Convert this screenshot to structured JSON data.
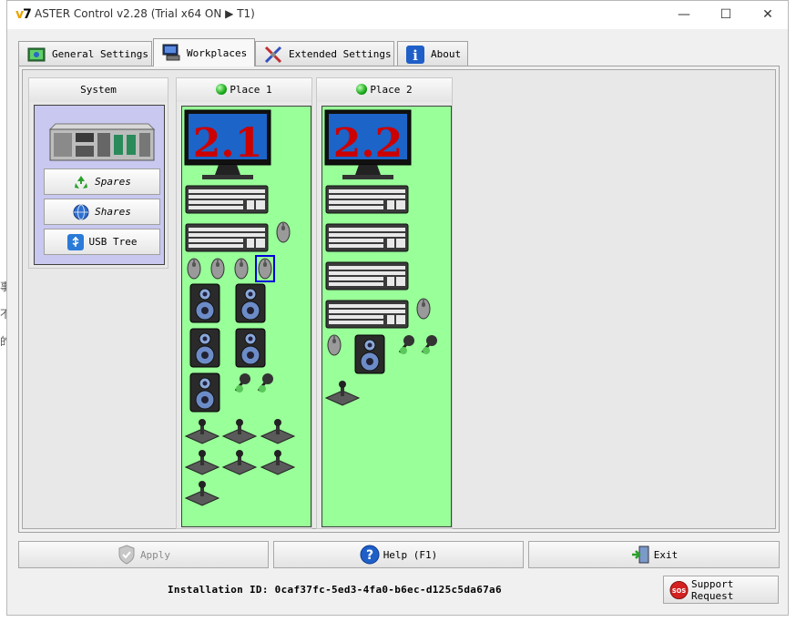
{
  "background_fragments": [
    "事",
    "不",
    "的"
  ],
  "window": {
    "title": "ASTER Control v2.28 (Trial x64 ON ▶ T1)",
    "app_icon_text": "v7",
    "minimize": "—",
    "maximize": "☐",
    "close": "✕"
  },
  "tabs": [
    {
      "label": "General Settings",
      "icon": "general-settings-icon",
      "active": false
    },
    {
      "label": "Workplaces",
      "icon": "workplaces-icon",
      "active": true
    },
    {
      "label": "Extended Settings",
      "icon": "extended-settings-icon",
      "active": false
    },
    {
      "label": "About",
      "icon": "info-icon",
      "active": false
    }
  ],
  "system": {
    "header": "System",
    "buttons": [
      {
        "label": "Spares",
        "icon": "recycle-icon"
      },
      {
        "label": "Shares",
        "icon": "globe-icon"
      },
      {
        "label": "USB Tree",
        "icon": "usb-icon"
      }
    ]
  },
  "places": [
    {
      "header": "Place 1",
      "monitor_label": "2.1",
      "status_color": "#18a818"
    },
    {
      "header": "Place 2",
      "monitor_label": "2.2",
      "status_color": "#18a818"
    }
  ],
  "buttons": {
    "apply": "Apply",
    "help": "Help (F1)",
    "exit": "Exit",
    "support": "Support Request",
    "sos": "SOS"
  },
  "installation_id": "Installation ID: 0caf37fc-5ed3-4fa0-b6ec-d125c5da67a6",
  "colors": {
    "workplace_bg": "#99ff99",
    "system_bg": "#c8c8f0",
    "monitor_digits": "#cc0000",
    "selected_outline": "#0000dd"
  }
}
